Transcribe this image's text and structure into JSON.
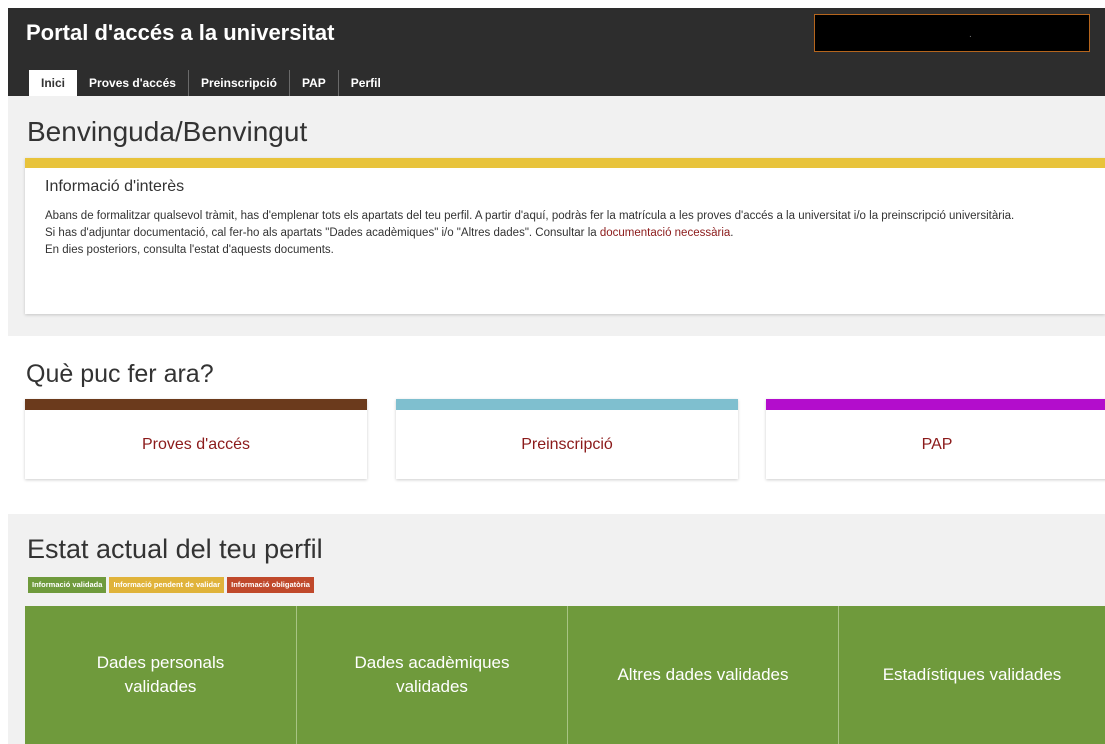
{
  "header": {
    "title": "Portal d'accés a la universitat",
    "user_box": ".",
    "tabs": [
      {
        "label": "Inici",
        "active": true
      },
      {
        "label": "Proves d'accés"
      },
      {
        "label": "Preinscripció"
      },
      {
        "label": "PAP"
      },
      {
        "label": "Perfil"
      }
    ]
  },
  "welcome": {
    "title": "Benvinguda/Benvingut",
    "info": {
      "title": "Informació d'interès",
      "line1": "Abans de formalitzar qualsevol tràmit, has d'emplenar tots els apartats del teu perfil. A partir d'aquí, podràs fer la matrícula a les proves d'accés a la universitat i/o la preinscripció universitària.",
      "line2_before": "Si has d'adjuntar documentació, cal fer-ho als apartats \"Dades acadèmiques\" i/o \"Altres dades\". Consultar la ",
      "line2_link": "documentació necessària",
      "line2_after": ".",
      "line3": "En dies posteriors, consulta l'estat d'aquests documents."
    }
  },
  "actions": {
    "title": "Què puc fer ara?",
    "cards": [
      {
        "label": "Proves d'accés",
        "color": "#6b3a1c"
      },
      {
        "label": "Preinscripció",
        "color": "#7fbfcf"
      },
      {
        "label": "PAP",
        "color": "#b30dcc"
      }
    ]
  },
  "status": {
    "title": "Estat actual del teu perfil",
    "legend": [
      {
        "label": "Informació validada",
        "color": "#6f9a3c"
      },
      {
        "label": "Informació pendent de validar",
        "color": "#e0b33a"
      },
      {
        "label": "Informació obligatòria",
        "color": "#c0492b"
      }
    ],
    "tiles": [
      {
        "label": "Dades personals validades",
        "color": "#6f9a3c"
      },
      {
        "label": "Dades acadèmiques validades",
        "color": "#6f9a3c"
      },
      {
        "label": "Altres dades validades",
        "color": "#6f9a3c"
      },
      {
        "label": "Estadístiques validades",
        "color": "#6f9a3c"
      }
    ]
  }
}
